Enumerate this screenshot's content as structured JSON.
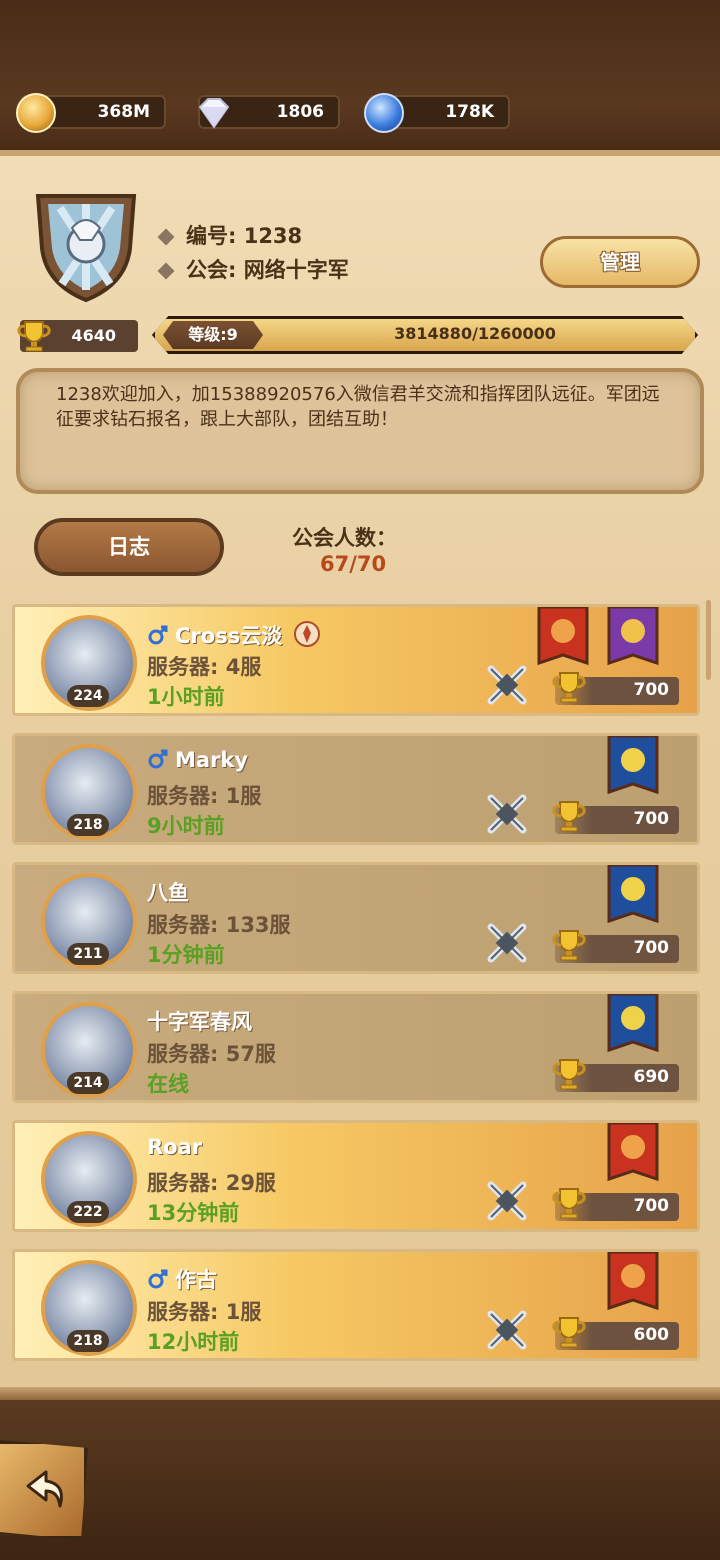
{
  "resources": [
    {
      "icon": "gold-coin-icon",
      "value": "368M"
    },
    {
      "icon": "diamond-icon",
      "value": "1806"
    },
    {
      "icon": "blue-crystal-icon",
      "value": "178K"
    }
  ],
  "guild": {
    "id_label": "编号: 1238",
    "name_label": "公会: 网络十字军",
    "manage_label": "管理",
    "trophies": "4640",
    "level_label": "等级:9",
    "xp_text": "3814880/1260000",
    "xp_fill_fraction": 1.0,
    "notice": "1238欢迎加入，加15388920576入微信君羊交流和指挥团队远征。军团远征要求钻石报名，跟上大部队，团结互助！",
    "log_label": "日志",
    "member_count_label": "公会人数：",
    "member_count_value": "67/70"
  },
  "members": [
    {
      "name": "Cross云淡",
      "gender": "male",
      "level": "224",
      "server": "服务器: 4服",
      "last_online": "1小时前",
      "score": "700",
      "style": "gold",
      "banners": [
        "red",
        "purple"
      ],
      "swords": true,
      "guild_badge": true
    },
    {
      "name": "Marky",
      "gender": "male",
      "level": "218",
      "server": "服务器: 1服",
      "last_online": "9小时前",
      "score": "700",
      "style": "plain",
      "banners": [
        "blue"
      ],
      "swords": true,
      "guild_badge": false
    },
    {
      "name": "八鱼",
      "gender": "",
      "level": "211",
      "server": "服务器: 133服",
      "last_online": "1分钟前",
      "score": "700",
      "style": "plain",
      "banners": [
        "blue"
      ],
      "swords": true,
      "guild_badge": false
    },
    {
      "name": "十字军春风",
      "gender": "",
      "level": "214",
      "server": "服务器: 57服",
      "last_online": "在线",
      "score": "690",
      "style": "plain",
      "banners": [
        "blue"
      ],
      "swords": false,
      "guild_badge": false
    },
    {
      "name": "Roar",
      "gender": "",
      "level": "222",
      "server": "服务器: 29服",
      "last_online": "13分钟前",
      "score": "700",
      "style": "gold",
      "banners": [
        "red-right"
      ],
      "swords": true,
      "guild_badge": false
    },
    {
      "name": "作古",
      "gender": "male",
      "level": "218",
      "server": "服务器: 1服",
      "last_online": "12小时前",
      "score": "600",
      "style": "gold",
      "banners": [
        "red-right"
      ],
      "swords": true,
      "guild_badge": false
    }
  ]
}
